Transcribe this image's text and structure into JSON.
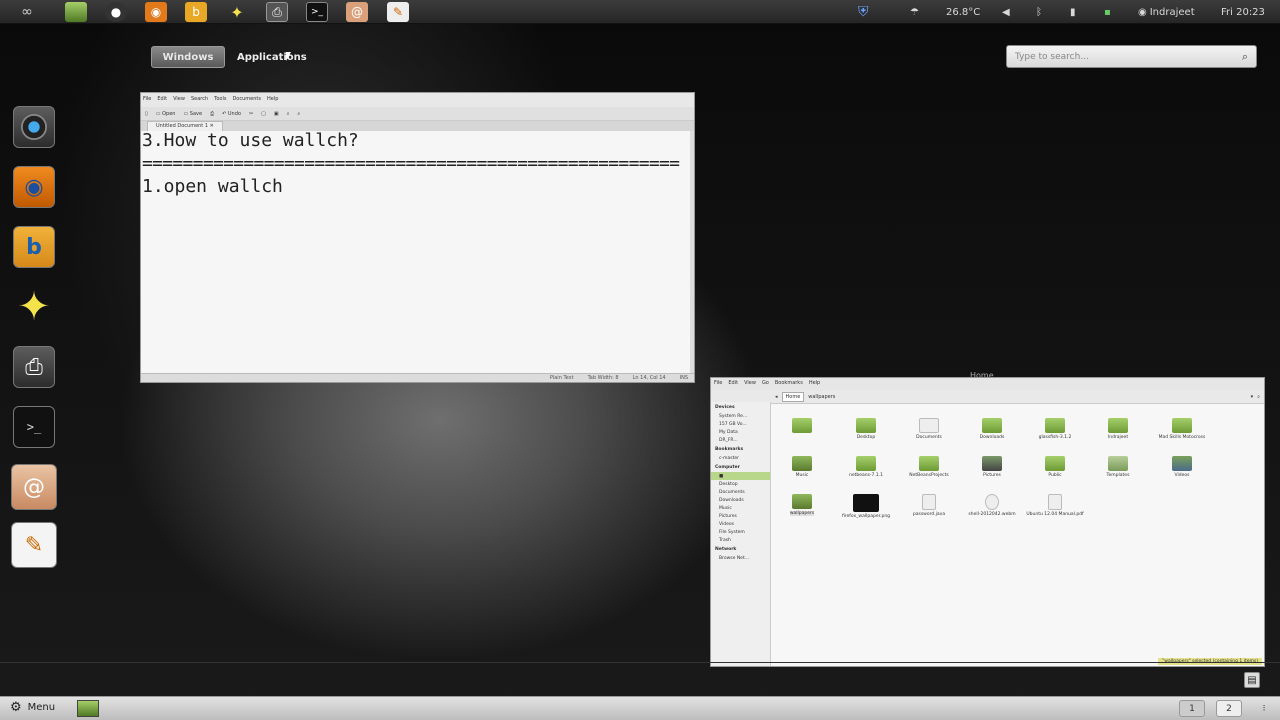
{
  "top_panel": {
    "launchers": [
      "shell-logo-icon",
      "file-manager-icon",
      "camera-icon",
      "webcam-icon",
      "blender-icon",
      "star-icon",
      "scanner-icon",
      "terminal-icon",
      "shell-app-icon",
      "text-editor-icon"
    ],
    "temperature": "26.8°C",
    "user": "Indrajeet",
    "clock": "Fri 20:23"
  },
  "overview": {
    "windows_tab": "Windows",
    "applications_tab": "Applications",
    "search_placeholder": "Type to search..."
  },
  "dock": {
    "items": [
      "cheese-camera-icon",
      "webcam-viewer-icon",
      "blender-icon",
      "star-icon",
      "scanner-icon",
      "terminal-icon",
      "shell-icon",
      "text-editor-icon"
    ]
  },
  "editor": {
    "menu": [
      "File",
      "Edit",
      "View",
      "Search",
      "Tools",
      "Documents",
      "Help"
    ],
    "toolbar": [
      "Open",
      "Save",
      "Undo"
    ],
    "tab_label": "Untitled Document 1",
    "line1": "3.How to use wallch?",
    "line2": "=====================================================",
    "line3": "1.open wallch",
    "status": [
      "Plain Text",
      "Tab Width: 8",
      "Ln 14, Col 14",
      "INS"
    ]
  },
  "filemgr": {
    "title": "Home",
    "menu": [
      "File",
      "Edit",
      "View",
      "Go",
      "Bookmarks",
      "Help"
    ],
    "crumbs": [
      "Home",
      "wallpapers"
    ],
    "sidebar": {
      "devices_head": "Devices",
      "devices": [
        "System Re...",
        "157 GB Vo...",
        "My Data",
        "DR_FR..."
      ],
      "bookmarks_head": "Bookmarks",
      "bookmarks": [
        "c-master"
      ],
      "computer_head": "Computer",
      "computer": [
        "■",
        "Desktop",
        "Documents",
        "Downloads",
        "Music",
        "Pictures",
        "Videos",
        "File System",
        "Trash"
      ],
      "network_head": "Network",
      "network": [
        "Browse Net..."
      ]
    },
    "items": [
      {
        "label": "",
        "type": "folder"
      },
      {
        "label": "Desktop",
        "type": "folder"
      },
      {
        "label": "Documents",
        "type": "folder"
      },
      {
        "label": "Downloads",
        "type": "folder"
      },
      {
        "label": "glassfish-3.1.2",
        "type": "folder"
      },
      {
        "label": "Indrajeet",
        "type": "folder"
      },
      {
        "label": "Mad Skills Motocross",
        "type": "folder"
      },
      {
        "label": "Music",
        "type": "folder"
      },
      {
        "label": "netbeans-7.1.1",
        "type": "folder"
      },
      {
        "label": "NetBeansProjects",
        "type": "folder"
      },
      {
        "label": "Pictures",
        "type": "folder"
      },
      {
        "label": "Public",
        "type": "folder"
      },
      {
        "label": "Templates",
        "type": "folder"
      },
      {
        "label": "Videos",
        "type": "folder"
      },
      {
        "label": "wallpapers",
        "type": "folder"
      },
      {
        "label": "firefox_wallpaper.png",
        "type": "img"
      },
      {
        "label": "password.java",
        "type": "doc"
      },
      {
        "label": "shell-2012042.webm",
        "type": "doc"
      },
      {
        "label": "Ubuntu 12.04 Manual.pdf",
        "type": "doc"
      }
    ],
    "status": "\"wallpapers\" selected (containing 1 items)"
  },
  "bottom_panel": {
    "menu_label": "Menu",
    "workspace_1": "1",
    "workspace_2": "2"
  }
}
